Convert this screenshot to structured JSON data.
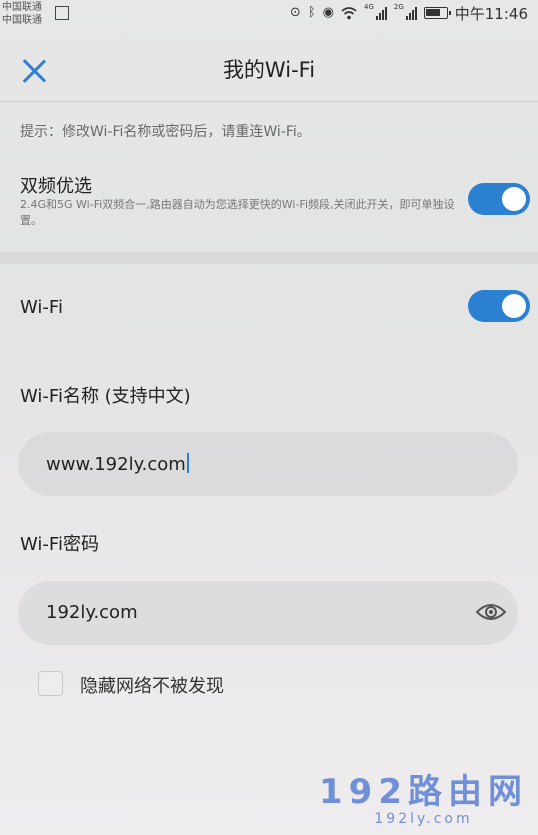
{
  "status_bar": {
    "carrier_1": "中国联通",
    "carrier_2": "中国联通",
    "time": "中午11:46",
    "net_4g": "4G",
    "net_2g": "2G",
    "icons": [
      "location-icon",
      "bluetooth-icon",
      "eye-care-icon",
      "wifi-icon",
      "signal-icon",
      "battery-icon"
    ]
  },
  "header": {
    "title": "我的Wi-Fi",
    "close_icon": "close-icon"
  },
  "hint": "提示：修改Wi-Fi名称或密码后，请重连Wi-Fi。",
  "dual_band": {
    "title": "双频优选",
    "description": "2.4G和5G Wi-Fi双频合一,路由器自动为您选择更快的Wi-Fi频段,关闭此开关，即可单独设置。",
    "enabled": true
  },
  "wifi": {
    "label": "Wi-Fi",
    "enabled": true
  },
  "wifi_name": {
    "label": "Wi-Fi名称 (支持中文)",
    "value": "www.192ly.com"
  },
  "wifi_password": {
    "label": "Wi-Fi密码",
    "value": "192ly.com"
  },
  "hide_network": {
    "label": "隐藏网络不被发现",
    "checked": false
  },
  "watermark": {
    "main": "192路由网",
    "sub": "192ly.com"
  },
  "colors": {
    "accent": "#2c80d0",
    "close": "#2f7fd0"
  }
}
